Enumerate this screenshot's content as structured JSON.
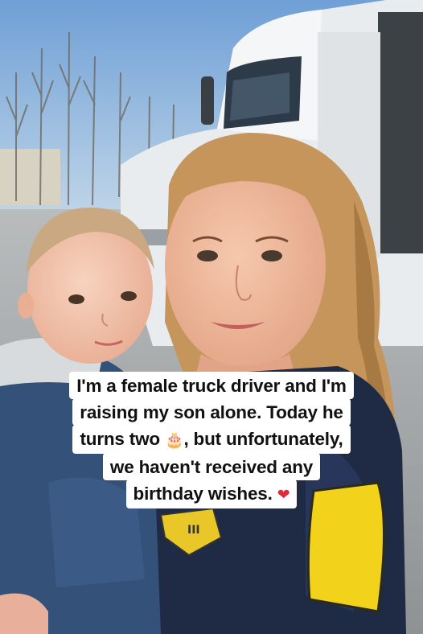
{
  "caption": {
    "line1": "I'm a female truck driver and I'm",
    "line2": "raising my son alone. Today he",
    "line3_a": "turns two ",
    "line3_emoji": "🎂",
    "line3_b": ", but unfortunately,",
    "line4": "we haven't received any",
    "line5_a": "birthday wishes. ",
    "line5_emoji": "❤"
  },
  "colors": {
    "sky": "#9fc3e6",
    "truck": "#eef0f2",
    "jacket": "#1f2b45",
    "patch": "#f2d21a",
    "hair_woman": "#c79a62",
    "hair_baby": "#c9a882"
  },
  "icons": [
    "birthday-cake-icon",
    "red-heart-icon"
  ]
}
